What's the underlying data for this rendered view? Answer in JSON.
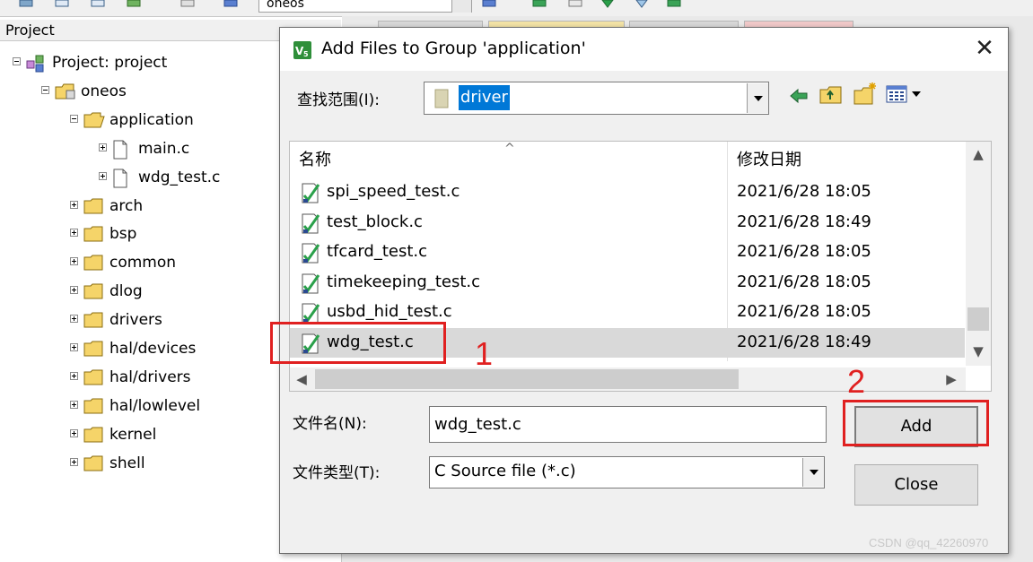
{
  "toolbar": {
    "target_combo_value": "oneos"
  },
  "project_pane": {
    "header": "Project",
    "tree": [
      {
        "label": "Project: project",
        "kind": "project",
        "expander": "minus",
        "level": 0
      },
      {
        "label": "oneos",
        "kind": "target",
        "expander": "minus",
        "level": 1
      },
      {
        "label": "application",
        "kind": "folder-open",
        "expander": "minus",
        "level": 2
      },
      {
        "label": "main.c",
        "kind": "file",
        "expander": "plus",
        "level": 3
      },
      {
        "label": "wdg_test.c",
        "kind": "file",
        "expander": "plus",
        "level": 3
      },
      {
        "label": "arch",
        "kind": "folder",
        "expander": "plus",
        "level": 2
      },
      {
        "label": "bsp",
        "kind": "folder",
        "expander": "plus",
        "level": 2
      },
      {
        "label": "common",
        "kind": "folder",
        "expander": "plus",
        "level": 2
      },
      {
        "label": "dlog",
        "kind": "folder",
        "expander": "plus",
        "level": 2
      },
      {
        "label": "drivers",
        "kind": "folder",
        "expander": "plus",
        "level": 2
      },
      {
        "label": "hal/devices",
        "kind": "folder",
        "expander": "plus",
        "level": 2
      },
      {
        "label": "hal/drivers",
        "kind": "folder",
        "expander": "plus",
        "level": 2
      },
      {
        "label": "hal/lowlevel",
        "kind": "folder",
        "expander": "plus",
        "level": 2
      },
      {
        "label": "kernel",
        "kind": "folder",
        "expander": "plus",
        "level": 2
      },
      {
        "label": "shell",
        "kind": "folder",
        "expander": "plus",
        "level": 2
      }
    ]
  },
  "dialog": {
    "title": "Add Files to Group 'application'",
    "close_glyph": "✕",
    "look_in": {
      "label": "查找范围(I):",
      "value": "driver"
    },
    "nav_icons": [
      "back-arrow-icon",
      "up-folder-icon",
      "new-folder-icon",
      "view-menu-icon"
    ],
    "list": {
      "columns": {
        "name": "名称",
        "date": "修改日期"
      },
      "rows": [
        {
          "name": "spi_speed_test.c",
          "date": "2021/6/28 18:05",
          "selected": false
        },
        {
          "name": "test_block.c",
          "date": "2021/6/28 18:49",
          "selected": false
        },
        {
          "name": "tfcard_test.c",
          "date": "2021/6/28 18:05",
          "selected": false
        },
        {
          "name": "timekeeping_test.c",
          "date": "2021/6/28 18:05",
          "selected": false
        },
        {
          "name": "usbd_hid_test.c",
          "date": "2021/6/28 18:05",
          "selected": false
        },
        {
          "name": "wdg_test.c",
          "date": "2021/6/28 18:49",
          "selected": true
        }
      ]
    },
    "file_name": {
      "label": "文件名(N):",
      "value": "wdg_test.c"
    },
    "file_type": {
      "label": "文件类型(T):",
      "value": "C Source file (*.c)"
    },
    "buttons": {
      "add": "Add",
      "close": "Close"
    }
  },
  "annotations": {
    "step1": "1",
    "step2": "2",
    "color": "#e02020"
  },
  "watermark": "CSDN @qq_42260970",
  "colors": {
    "selection": "#d9d9d9",
    "highlight": "#0078d7",
    "dialog_bg": "#f0f0f0"
  }
}
